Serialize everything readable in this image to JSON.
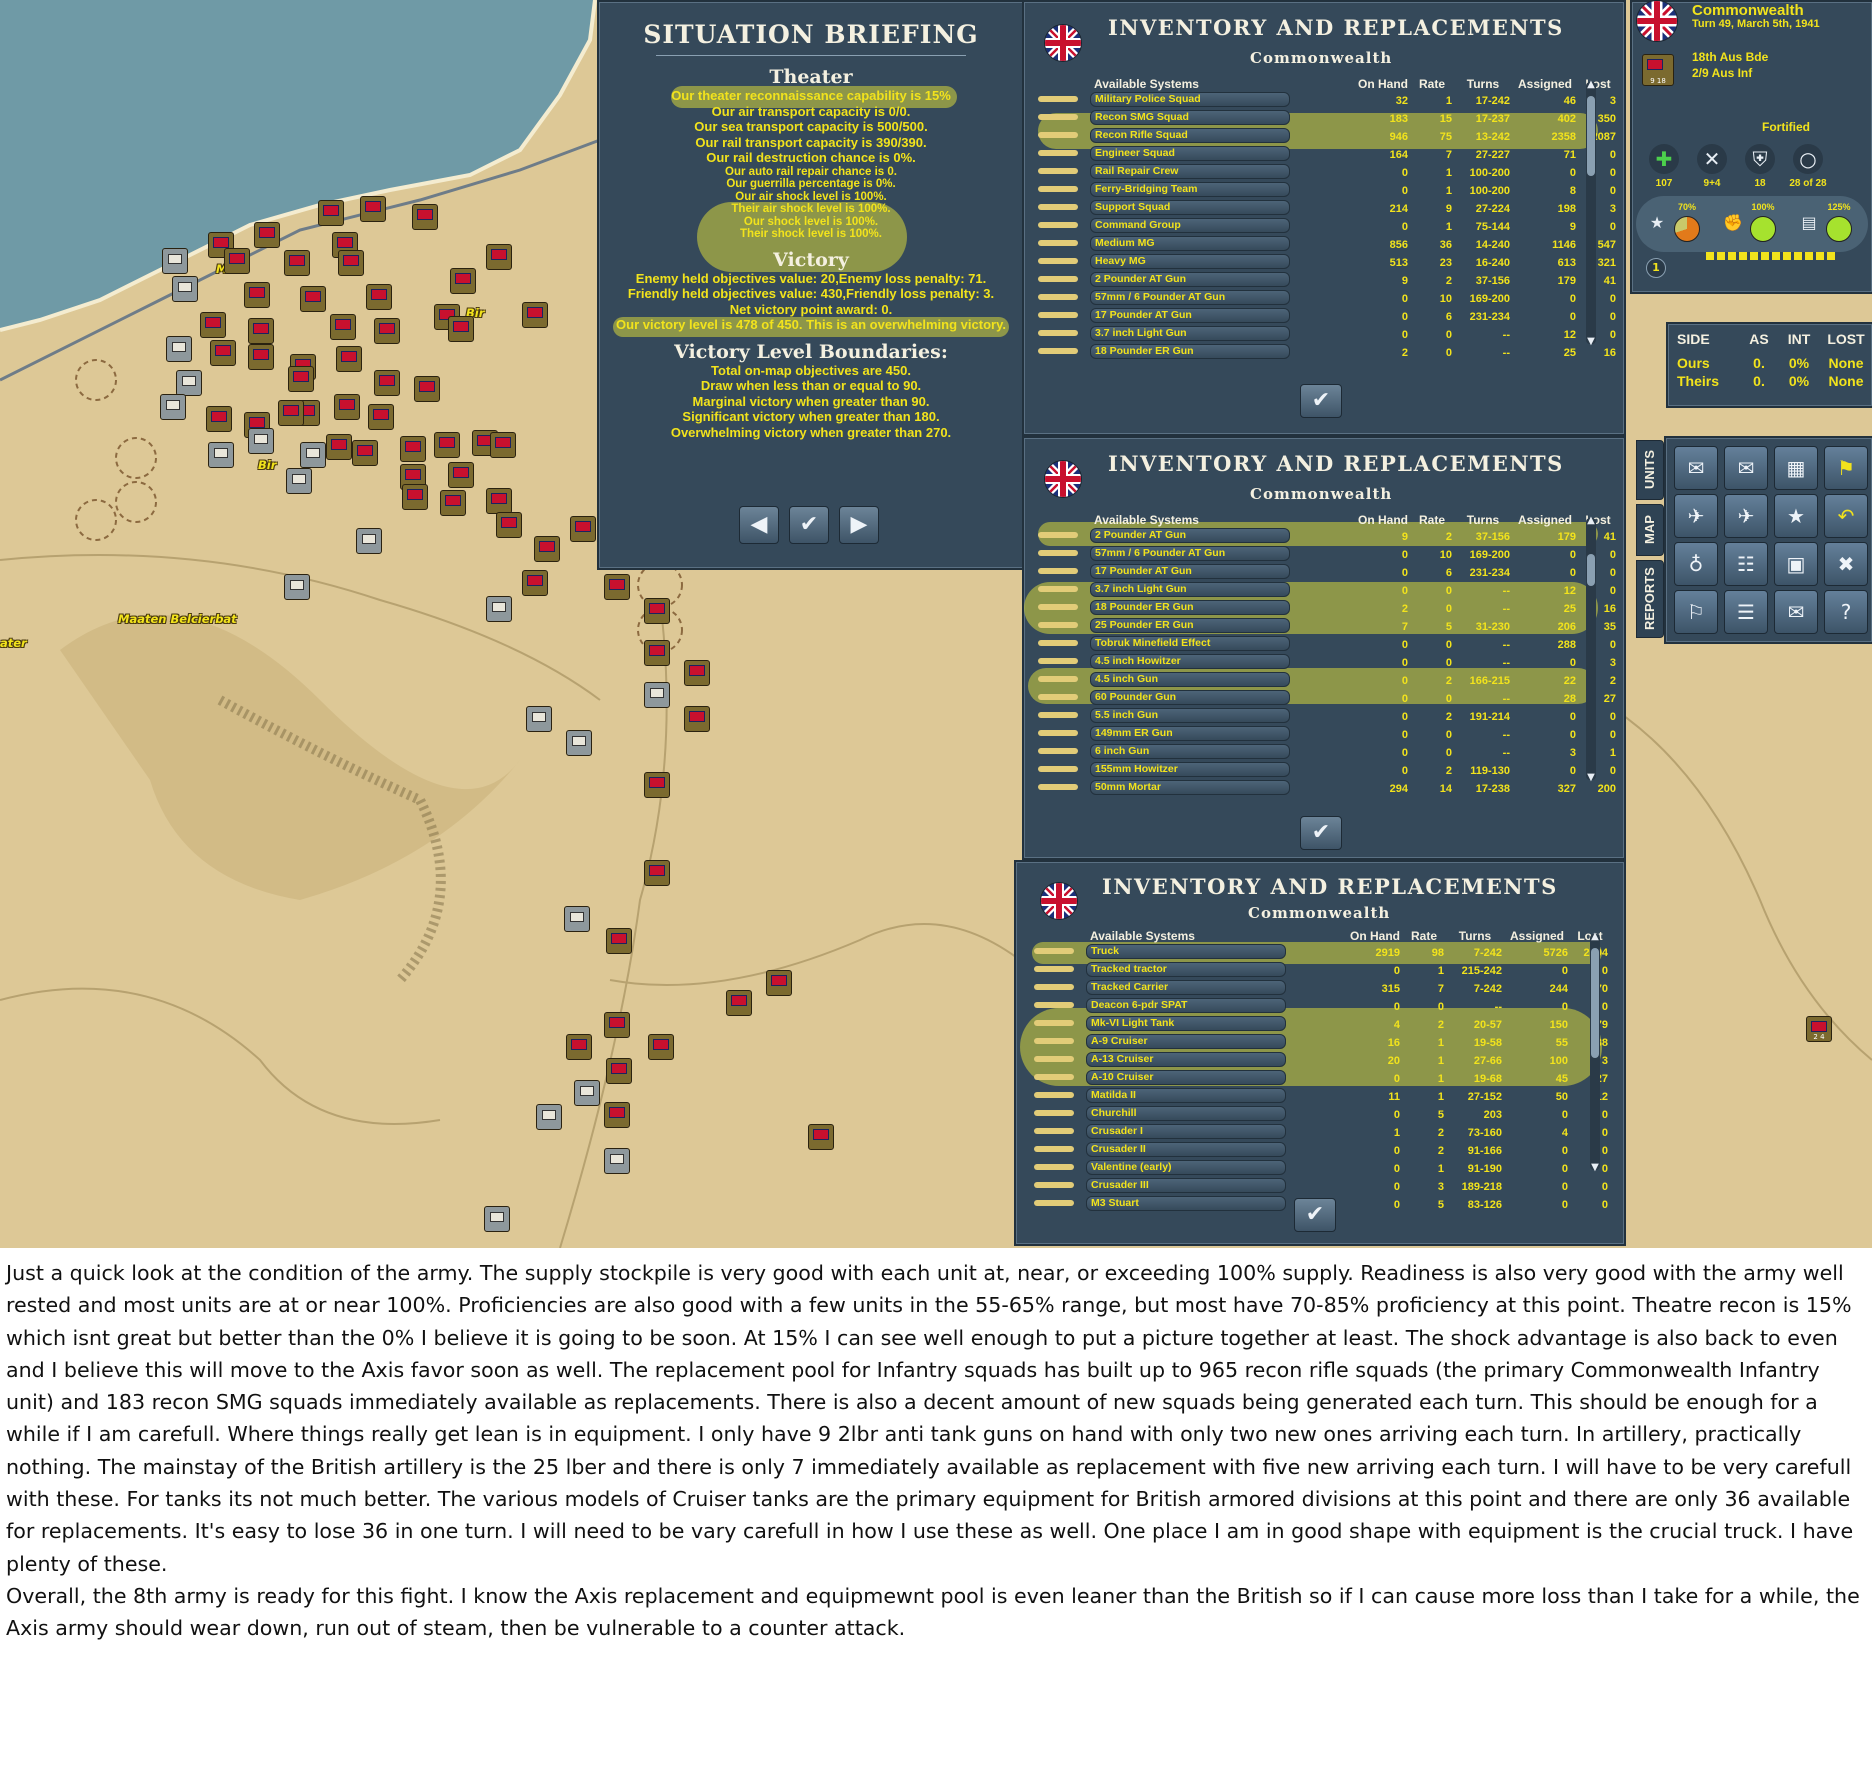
{
  "colors": {
    "panel_bg": "#35495a",
    "text_gold": "#f2e31c",
    "highlight": "#d6d63c",
    "sea": "#6f9aa6",
    "desert": "#ddc896"
  },
  "briefing": {
    "title": "SITUATION BRIEFING",
    "theater_heading": "Theater",
    "theater_lines": [
      "Our theater reconnaissance capability is 15%",
      "Our air transport capacity is 0/0.",
      "Our sea transport capacity is 500/500.",
      "Our rail transport capacity is 390/390.",
      "Our rail destruction chance is 0%.",
      "Our auto rail repair chance is 0.",
      "Our guerrilla percentage is 0%.",
      "Our air shock level is 100%.",
      "Their air shock level is 100%.",
      "Our shock level is 100%.",
      "Their shock level is 100%."
    ],
    "victory_heading": "Victory",
    "victory_lines": [
      "Enemy held objectives value: 20,Enemy loss penalty: 71.",
      "Friendly held objectives value: 430,Friendly loss penalty: 3.",
      "Net victory point award: 0.",
      "Our victory level is 478 of 450. This is an overwhelming victory."
    ],
    "boundaries_heading": "Victory Level Boundaries:",
    "boundaries_lines": [
      "Total on-map objectives are 450.",
      "Draw when less than or equal to 90.",
      "Marginal victory when greater than 90.",
      "Significant victory when greater than 180.",
      "Overwhelming victory when greater than 270."
    ],
    "prev_icon": "arrow-left-icon",
    "ok_icon": "check-icon",
    "next_icon": "arrow-right-icon"
  },
  "inventory_title": "INVENTORY AND REPLACEMENTS",
  "inventory_side": "Commonwealth",
  "columns": [
    "Available Systems",
    "On Hand",
    "Rate",
    "Turns",
    "Assigned",
    "Lost"
  ],
  "inventory1": {
    "rows": [
      {
        "name": "Military Police Squad",
        "on_hand": "32",
        "rate": "1",
        "turns": "17-242",
        "assigned": "46",
        "lost": "3"
      },
      {
        "name": "Recon SMG Squad",
        "on_hand": "183",
        "rate": "15",
        "turns": "17-237",
        "assigned": "402",
        "lost": "350"
      },
      {
        "name": "Recon Rifle Squad",
        "on_hand": "946",
        "rate": "75",
        "turns": "13-242",
        "assigned": "2358",
        "lost": "2087"
      },
      {
        "name": "Engineer Squad",
        "on_hand": "164",
        "rate": "7",
        "turns": "27-227",
        "assigned": "71",
        "lost": "0"
      },
      {
        "name": "Rail Repair Crew",
        "on_hand": "0",
        "rate": "1",
        "turns": "100-200",
        "assigned": "0",
        "lost": "0"
      },
      {
        "name": "Ferry-Bridging Team",
        "on_hand": "0",
        "rate": "1",
        "turns": "100-200",
        "assigned": "8",
        "lost": "0"
      },
      {
        "name": "Support Squad",
        "on_hand": "214",
        "rate": "9",
        "turns": "27-224",
        "assigned": "198",
        "lost": "3"
      },
      {
        "name": "Command Group",
        "on_hand": "0",
        "rate": "1",
        "turns": "75-144",
        "assigned": "9",
        "lost": "0"
      },
      {
        "name": "Medium MG",
        "on_hand": "856",
        "rate": "36",
        "turns": "14-240",
        "assigned": "1146",
        "lost": "547"
      },
      {
        "name": "Heavy MG",
        "on_hand": "513",
        "rate": "23",
        "turns": "16-240",
        "assigned": "613",
        "lost": "321"
      },
      {
        "name": "2 Pounder AT Gun",
        "on_hand": "9",
        "rate": "2",
        "turns": "37-156",
        "assigned": "179",
        "lost": "41"
      },
      {
        "name": "57mm / 6 Pounder AT Gun",
        "on_hand": "0",
        "rate": "10",
        "turns": "169-200",
        "assigned": "0",
        "lost": "0"
      },
      {
        "name": "17 Pounder AT Gun",
        "on_hand": "0",
        "rate": "6",
        "turns": "231-234",
        "assigned": "0",
        "lost": "0"
      },
      {
        "name": "3.7 inch Light Gun",
        "on_hand": "0",
        "rate": "0",
        "turns": "--",
        "assigned": "12",
        "lost": "0"
      },
      {
        "name": "18 Pounder ER Gun",
        "on_hand": "2",
        "rate": "0",
        "turns": "--",
        "assigned": "25",
        "lost": "16"
      }
    ]
  },
  "inventory2": {
    "rows": [
      {
        "name": "2 Pounder AT Gun",
        "on_hand": "9",
        "rate": "2",
        "turns": "37-156",
        "assigned": "179",
        "lost": "41"
      },
      {
        "name": "57mm / 6 Pounder AT Gun",
        "on_hand": "0",
        "rate": "10",
        "turns": "169-200",
        "assigned": "0",
        "lost": "0"
      },
      {
        "name": "17 Pounder AT Gun",
        "on_hand": "0",
        "rate": "6",
        "turns": "231-234",
        "assigned": "0",
        "lost": "0"
      },
      {
        "name": "3.7 inch Light Gun",
        "on_hand": "0",
        "rate": "0",
        "turns": "--",
        "assigned": "12",
        "lost": "0"
      },
      {
        "name": "18 Pounder ER Gun",
        "on_hand": "2",
        "rate": "0",
        "turns": "--",
        "assigned": "25",
        "lost": "16"
      },
      {
        "name": "25 Pounder ER Gun",
        "on_hand": "7",
        "rate": "5",
        "turns": "31-230",
        "assigned": "206",
        "lost": "35"
      },
      {
        "name": "Tobruk Minefield Effect",
        "on_hand": "0",
        "rate": "0",
        "turns": "--",
        "assigned": "288",
        "lost": "0"
      },
      {
        "name": "4.5 inch Howitzer",
        "on_hand": "0",
        "rate": "0",
        "turns": "--",
        "assigned": "0",
        "lost": "3"
      },
      {
        "name": "4.5 inch Gun",
        "on_hand": "0",
        "rate": "2",
        "turns": "166-215",
        "assigned": "22",
        "lost": "2"
      },
      {
        "name": "60 Pounder Gun",
        "on_hand": "0",
        "rate": "0",
        "turns": "--",
        "assigned": "28",
        "lost": "27"
      },
      {
        "name": "5.5 inch Gun",
        "on_hand": "0",
        "rate": "2",
        "turns": "191-214",
        "assigned": "0",
        "lost": "0"
      },
      {
        "name": "149mm ER Gun",
        "on_hand": "0",
        "rate": "0",
        "turns": "--",
        "assigned": "0",
        "lost": "0"
      },
      {
        "name": "6 inch Gun",
        "on_hand": "0",
        "rate": "0",
        "turns": "--",
        "assigned": "3",
        "lost": "1"
      },
      {
        "name": "155mm Howitzer",
        "on_hand": "0",
        "rate": "2",
        "turns": "119-130",
        "assigned": "0",
        "lost": "0"
      },
      {
        "name": "50mm Mortar",
        "on_hand": "294",
        "rate": "14",
        "turns": "17-238",
        "assigned": "327",
        "lost": "200"
      }
    ]
  },
  "inventory3": {
    "rows": [
      {
        "name": "Truck",
        "on_hand": "2919",
        "rate": "98",
        "turns": "7-242",
        "assigned": "5726",
        "lost": "2394"
      },
      {
        "name": "Tracked tractor",
        "on_hand": "0",
        "rate": "1",
        "turns": "215-242",
        "assigned": "0",
        "lost": "0"
      },
      {
        "name": "Tracked Carrier",
        "on_hand": "315",
        "rate": "7",
        "turns": "7-242",
        "assigned": "244",
        "lost": "70"
      },
      {
        "name": "Deacon 6-pdr SPAT",
        "on_hand": "0",
        "rate": "0",
        "turns": "--",
        "assigned": "0",
        "lost": "0"
      },
      {
        "name": "Mk-VI Light Tank",
        "on_hand": "4",
        "rate": "2",
        "turns": "20-57",
        "assigned": "150",
        "lost": "79"
      },
      {
        "name": "A-9 Cruiser",
        "on_hand": "16",
        "rate": "1",
        "turns": "19-58",
        "assigned": "55",
        "lost": "38"
      },
      {
        "name": "A-13 Cruiser",
        "on_hand": "20",
        "rate": "1",
        "turns": "27-66",
        "assigned": "100",
        "lost": "3"
      },
      {
        "name": "A-10 Cruiser",
        "on_hand": "0",
        "rate": "1",
        "turns": "19-68",
        "assigned": "45",
        "lost": "27"
      },
      {
        "name": "Matilda II",
        "on_hand": "11",
        "rate": "1",
        "turns": "27-152",
        "assigned": "50",
        "lost": "12"
      },
      {
        "name": "Churchill",
        "on_hand": "0",
        "rate": "5",
        "turns": "203",
        "assigned": "0",
        "lost": "0"
      },
      {
        "name": "Crusader I",
        "on_hand": "1",
        "rate": "2",
        "turns": "73-160",
        "assigned": "4",
        "lost": "0"
      },
      {
        "name": "Crusader II",
        "on_hand": "0",
        "rate": "2",
        "turns": "91-166",
        "assigned": "0",
        "lost": "0"
      },
      {
        "name": "Valentine (early)",
        "on_hand": "0",
        "rate": "1",
        "turns": "91-190",
        "assigned": "0",
        "lost": "0"
      },
      {
        "name": "Crusader III",
        "on_hand": "0",
        "rate": "3",
        "turns": "189-218",
        "assigned": "0",
        "lost": "0"
      },
      {
        "name": "M3 Stuart",
        "on_hand": "0",
        "rate": "5",
        "turns": "83-126",
        "assigned": "0",
        "lost": "0"
      }
    ]
  },
  "status": {
    "side": "Commonwealth",
    "turn": "Turn 49, March 5th, 1941",
    "unit_name": "18th Aus Bde",
    "unit_sub": "2/9 Aus Inf",
    "unit_code": "9 18",
    "posture": "Fortified",
    "stats": [
      {
        "icon": "medic-cross-icon",
        "value": "107"
      },
      {
        "icon": "crossed-swords-icon",
        "value": "9+4"
      },
      {
        "icon": "shield-icon",
        "value": "18"
      },
      {
        "icon": "ring-icon",
        "value": "28 of 28"
      }
    ],
    "readiness": [
      {
        "icon": "star-icon",
        "value": "70%"
      },
      {
        "icon": "fist-icon",
        "value": "100%"
      },
      {
        "icon": "supply-icon",
        "value": "125%"
      }
    ],
    "level": "1"
  },
  "losses": {
    "headers": [
      "SIDE",
      "AS",
      "INT",
      "LOST"
    ],
    "rows": [
      {
        "side": "Ours",
        "as": "0.",
        "int": "0%",
        "lost": "None"
      },
      {
        "side": "Theirs",
        "as": "0.",
        "int": "0%",
        "lost": "None"
      }
    ]
  },
  "tabs": [
    "UNITS",
    "MAP",
    "REPORTS"
  ],
  "tools": [
    "unit-prev-icon",
    "unit-next-icon",
    "unit-list-icon",
    "objective-flag-icon",
    "air-prev-icon",
    "air-next-icon",
    "star-icon",
    "undo-icon",
    "org-chart-icon",
    "formation-icon",
    "replacement-icon",
    "disband-icon",
    "hold-icon",
    "reserve-icon",
    "report-icon",
    "help-icon"
  ],
  "map_labels": [
    "Mar",
    "Bir",
    "Bir",
    "Maaten Belcierbat",
    "ater"
  ],
  "caption": [
    "Just a quick look at the condition of the army. The supply stockpile is very good with each unit at, near, or exceeding 100% supply. Readiness is also very good with the army well rested and most units are at or near 100%. Proficiencies are also good with a few units in the 55-65% range, but most have 70-85% proficiency at this point. Theatre recon is 15% which isnt great but better than the 0% I believe it is going to be soon. At 15% I can see well enough to put a picture together at least. The shock advantage is also back to even and I believe this will move to the Axis favor soon as well. The replacement pool for Infantry squads has built up to 965 recon rifle squads (the primary Commonwealth Infantry unit) and 183 recon SMG squads immediately available as replacements. There is also a decent amount of new squads being generated each turn. This should be enough for a while if I am carefull. Where things really get lean is in equipment. I only have 9 2lbr anti tank guns on hand with only two new ones arriving each turn. In artillery, practically nothing. The mainstay of the British artillery is the 25 lber and there is only 7 immediately available as replacement with five new arriving each turn. I will have to be very carefull with these. For tanks its not much better. The various models of Cruiser tanks are the primary equipment  for British armored divisions at this point and there are only 36 available for replacements. It's easy to lose 36 in one turn. I will need to be vary carefull in how I use these as well. One place I am in good shape with equipment is the crucial truck. I have plenty of these.",
    "Overall, the 8th army is ready for this fight. I know the Axis replacement and equipmewnt pool is even leaner than the British so if I can cause more loss than I take for a while, the Axis army should wear down, run out of steam, then be vulnerable to a counter attack."
  ]
}
